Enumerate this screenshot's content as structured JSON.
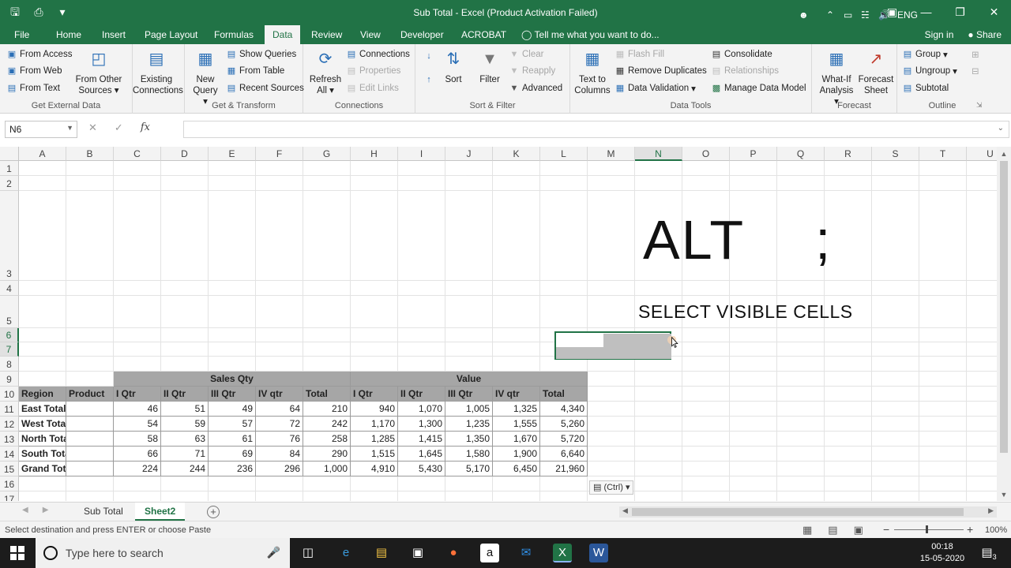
{
  "titlebar": {
    "title": "Sub Total - Excel (Product Activation Failed)"
  },
  "tabs": {
    "items": [
      "File",
      "Home",
      "Insert",
      "Page Layout",
      "Formulas",
      "Data",
      "Review",
      "View",
      "Developer",
      "ACROBAT"
    ],
    "active": "Data",
    "tell_me": "Tell me what you want to do...",
    "sign_in": "Sign in",
    "share": "Share"
  },
  "ribbon": {
    "get_external": {
      "label": "Get External Data",
      "from_access": "From Access",
      "from_web": "From Web",
      "from_text": "From Text",
      "from_other_1": "From Other",
      "from_other_2": "Sources",
      "existing_1": "Existing",
      "existing_2": "Connections"
    },
    "get_transform": {
      "label": "Get & Transform",
      "new_query_1": "New",
      "new_query_2": "Query",
      "show_queries": "Show Queries",
      "from_table": "From Table",
      "recent_sources": "Recent Sources"
    },
    "connections": {
      "label": "Connections",
      "refresh_1": "Refresh",
      "refresh_2": "All",
      "connections": "Connections",
      "properties": "Properties",
      "edit_links": "Edit Links"
    },
    "sort_filter": {
      "label": "Sort & Filter",
      "sort": "Sort",
      "filter": "Filter",
      "clear": "Clear",
      "reapply": "Reapply",
      "advanced": "Advanced"
    },
    "data_tools": {
      "label": "Data Tools",
      "text_to_1": "Text to",
      "text_to_2": "Columns",
      "flash_fill": "Flash Fill",
      "remove_duplicates": "Remove Duplicates",
      "data_validation": "Data Validation",
      "consolidate": "Consolidate",
      "relationships": "Relationships",
      "manage_data_model": "Manage Data Model"
    },
    "forecast": {
      "label": "Forecast",
      "what_if_1": "What-If",
      "what_if_2": "Analysis",
      "forecast_1": "Forecast",
      "forecast_2": "Sheet"
    },
    "outline": {
      "label": "Outline",
      "group": "Group",
      "ungroup": "Ungroup",
      "subtotal": "Subtotal"
    }
  },
  "formula_bar": {
    "name_box": "N6",
    "cancel": "✕",
    "enter": "✓",
    "fx": "fx",
    "value": ""
  },
  "grid": {
    "columns": [
      "A",
      "B",
      "C",
      "D",
      "E",
      "F",
      "G",
      "H",
      "I",
      "J",
      "K",
      "L",
      "M",
      "N",
      "O",
      "P",
      "Q",
      "R",
      "S",
      "T",
      "U"
    ],
    "rows": [
      "1",
      "2",
      "3",
      "4",
      "5",
      "6",
      "7",
      "8",
      "9",
      "10",
      "11",
      "12",
      "13",
      "14",
      "15",
      "16",
      "17"
    ],
    "selected_column": "N",
    "selected_rows": [
      "6",
      "7"
    ],
    "big_text": "ALT",
    "big_symbol": ";",
    "sub_text": "SELECT VISIBLE CELLS"
  },
  "table": {
    "group_headers": [
      "Sales Qty",
      "Value"
    ],
    "headers": [
      "Region",
      "Product",
      "I Qtr",
      "II Qtr",
      "III Qtr",
      "IV qtr",
      "Total",
      "I Qtr",
      "II Qtr",
      "III Qtr",
      "IV qtr",
      "Total"
    ],
    "rows": [
      [
        "East Total",
        "",
        "46",
        "51",
        "49",
        "64",
        "210",
        "940",
        "1,070",
        "1,005",
        "1,325",
        "4,340"
      ],
      [
        "West Total",
        "",
        "54",
        "59",
        "57",
        "72",
        "242",
        "1,170",
        "1,300",
        "1,235",
        "1,555",
        "5,260"
      ],
      [
        "North Total",
        "",
        "58",
        "63",
        "61",
        "76",
        "258",
        "1,285",
        "1,415",
        "1,350",
        "1,670",
        "5,720"
      ],
      [
        "South Total",
        "",
        "66",
        "71",
        "69",
        "84",
        "290",
        "1,515",
        "1,645",
        "1,580",
        "1,900",
        "6,640"
      ],
      [
        "Grand Total",
        "",
        "224",
        "244",
        "236",
        "296",
        "1,000",
        "4,910",
        "5,430",
        "5,170",
        "6,450",
        "21,960"
      ]
    ]
  },
  "paste_options": "(Ctrl)",
  "sheets": {
    "tabs": [
      "Sub Total",
      "Sheet2"
    ],
    "active": "Sheet2"
  },
  "status": {
    "message": "Select destination and press ENTER or choose Paste",
    "zoom": "100%"
  },
  "taskbar": {
    "search_placeholder": "Type here to search",
    "lang": "ENG",
    "time": "00:18",
    "date": "15-05-2020",
    "notifications": "3"
  }
}
